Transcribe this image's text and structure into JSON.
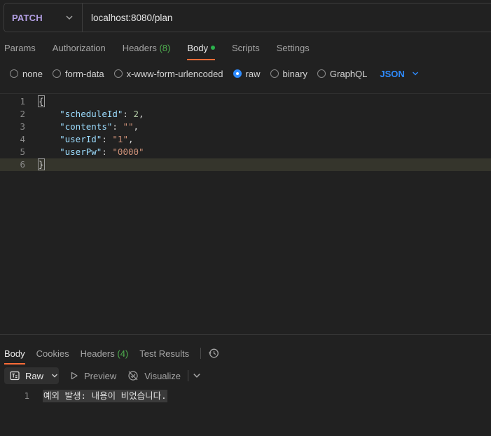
{
  "request": {
    "method": "PATCH",
    "url": "localhost:8080/plan"
  },
  "req_tabs": [
    {
      "label": "Params"
    },
    {
      "label": "Authorization"
    },
    {
      "label": "Headers",
      "count": "(8)"
    },
    {
      "label": "Body"
    },
    {
      "label": "Scripts"
    },
    {
      "label": "Settings"
    }
  ],
  "body_types": {
    "none": "none",
    "form_data": "form-data",
    "urlencoded": "x-www-form-urlencoded",
    "raw": "raw",
    "binary": "binary",
    "graphql": "GraphQL",
    "selected": "raw",
    "format": "JSON"
  },
  "editor": {
    "line_numbers": [
      "1",
      "2",
      "3",
      "4",
      "5",
      "6"
    ],
    "open_brace": "{",
    "close_brace": "}",
    "fields": [
      {
        "key": "\"scheduleId\"",
        "value": "2",
        "comma": ","
      },
      {
        "key": "\"contents\"",
        "value": "\"\"",
        "comma": ","
      },
      {
        "key": "\"userId\"",
        "value": "\"1\"",
        "comma": ","
      },
      {
        "key": "\"userPw\"",
        "value": "\"0000\"",
        "comma": ""
      }
    ]
  },
  "res_tabs": [
    {
      "label": "Body"
    },
    {
      "label": "Cookies"
    },
    {
      "label": "Headers",
      "count": "(4)"
    },
    {
      "label": "Test Results"
    }
  ],
  "res_toolbar": {
    "raw_label": "Raw",
    "preview_label": "Preview",
    "visualize_label": "Visualize"
  },
  "response": {
    "line_number": "1",
    "text": "예외 발생: 내용이 비었습니다."
  },
  "colors": {
    "accent": "#ff6c37",
    "method": "#b4a0e5",
    "link_blue": "#2f8cff",
    "count_green": "#4fb04f"
  }
}
